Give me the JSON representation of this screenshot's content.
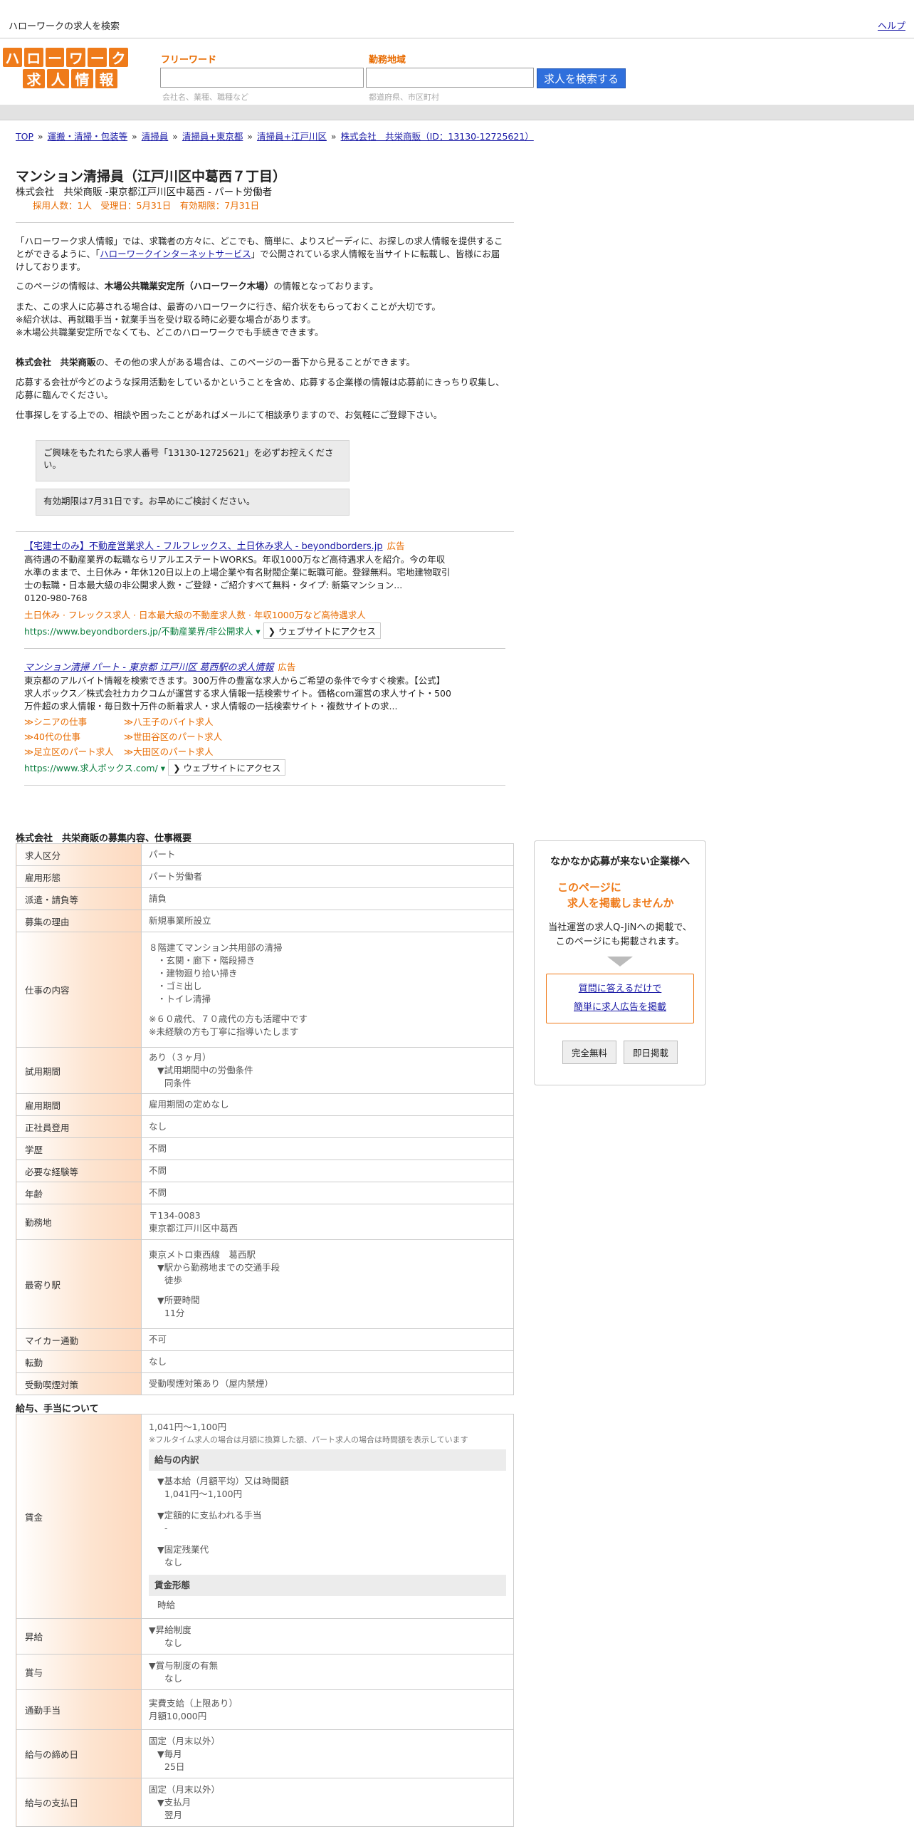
{
  "topbar": {
    "title": "ハローワークの求人を検索",
    "help": "ヘルプ"
  },
  "logo": {
    "row1": [
      "ハ",
      "ロ",
      "ー",
      "ワ",
      "ー",
      "ク"
    ],
    "row2": [
      "求",
      "人",
      "情",
      "報"
    ]
  },
  "search": {
    "freeword_label": "フリーワード",
    "freeword_hint": "会社名、業種、職種など",
    "area_label": "勤務地域",
    "area_hint": "都道府県、市区町村",
    "button": "求人を検索する"
  },
  "breadcrumb": [
    {
      "text": "TOP",
      "sep": " » "
    },
    {
      "text": "運搬・清掃・包装等",
      "sep": " » "
    },
    {
      "text": "清掃員",
      "sep": " » "
    },
    {
      "text": "清掃員+東京都",
      "sep": " » "
    },
    {
      "text": "清掃員+江戸川区",
      "sep": " » "
    },
    {
      "text": "株式会社　共栄商販（ID：13130-12725621）",
      "sep": ""
    }
  ],
  "job": {
    "title": "マンション清掃員（江戸川区中葛西７丁目）",
    "subtitle": "株式会社　共栄商販 -東京都江戸川区中葛西 - パート労働者",
    "meta": "採用人数：1人　受理日：5月31日　有効期限：7月31日"
  },
  "intro": {
    "p1a": "「ハローワーク求人情報」では、求職者の方々に、どこでも、簡単に、よりスピーディに、お探しの求人情報を提供することができるように、「",
    "p1link": "ハローワークインターネットサービス",
    "p1b": "」で公開されている求人情報を当サイトに転載し、皆様にお届けしております。",
    "p2a": "このページの情報は、",
    "p2b": "木場公共職業安定所（ハローワーク木場）",
    "p2c": "の情報となっております。",
    "p3": "また、この求人に応募される場合は、最寄のハローワークに行き、紹介状をもらっておくことが大切です。",
    "p4": "※紹介状は、再就職手当・就業手当を受け取る時に必要な場合があります。",
    "p5": "※木場公共職業安定所でなくても、どこのハローワークでも手続きできます。",
    "p6a": "株式会社　共栄商販",
    "p6b": "の、その他の求人がある場合は、このページの一番下から見ることができます。",
    "p7": "応募する会社が今どのような採用活動をしているかということを含め、応募する企業様の情報は応募前にきっちり収集し、応募に臨んでください。",
    "p8": "仕事探しをする上での、相談や困ったことがあればメールにて相談承りますので、お気軽にご登録下さい。"
  },
  "notices": [
    "ご興味をもたれたら求人番号「13130-12725621」を必ずお控えください。",
    "有効期限は7月31日です。お早めにご検討ください。"
  ],
  "ads": [
    {
      "title": "【宅建士のみ】不動産営業求人 - フルフレックス、土日休み求人 - beyondborders.jp",
      "badge": "広告",
      "desc": "高待遇の不動産業界の転職ならリアルエステートWORKS。年収1000万など高待遇求人を紹介。今の年収水準のままで、土日休み・年休120日以上の上場企業や有名財閥企業に転職可能。登録無料。宅地建物取引士の転職・日本最大級の非公開求人数・ご登録・ご紹介すべて無料・タイプ: 新築マンション...",
      "phone": "0120-980-768",
      "sub": "土日休み · フレックス求人 · 日本最大級の不動産求人数 · 年収1000万など高待遇求人",
      "url": "https://www.beyondborders.jp/不動産業界/非公開求人",
      "visit": "ウェブサイトにアクセス"
    },
    {
      "title": "マンション清掃 パート - 東京都 江戸川区 葛西駅の求人情報",
      "badge": "広告",
      "desc": "東京都のアルバイト情報を検索できます。300万件の豊富な求人からご希望の条件で今すぐ検索。【公式】求人ボックス／株式会社カカクコムが運営する求人情報一括検索サイト。価格com運営の求人サイト・500万件超の求人情報・毎日数十万件の新着求人・求人情報の一括検索サイト・複数サイトの求...",
      "links": [
        "≫シニアの仕事",
        "≫八王子のバイト求人",
        "≫40代の仕事",
        "≫世田谷区のパート求人",
        "≫足立区のパート求人",
        "≫大田区のパート求人"
      ],
      "url": "https://www.求人ボックス.com/",
      "visit": "ウェブサイトにアクセス"
    }
  ],
  "overview": {
    "heading": "株式会社　共栄商販の募集内容、仕事概要",
    "rows": [
      {
        "k": "求人区分",
        "v": [
          "パート"
        ]
      },
      {
        "k": "雇用形態",
        "v": [
          "パート労働者"
        ]
      },
      {
        "k": "派遣・請負等",
        "v": [
          "請負"
        ]
      },
      {
        "k": "募集の理由",
        "v": [
          "新規事業所設立"
        ]
      },
      {
        "k": "仕事の内容",
        "v": [
          "８階建てマンション共用部の清掃",
          "・玄関・廊下・階段掃き",
          "・建物廻り拾い掃き",
          "・ゴミ出し",
          "・トイレ清掃",
          "",
          "※６０歳代、７０歳代の方も活躍中です",
          "※未経験の方も丁寧に指導いたします"
        ]
      },
      {
        "k": "試用期間",
        "v": [
          "あり（３ヶ月）",
          "▼試用期間中の労働条件",
          "同条件"
        ]
      },
      {
        "k": "雇用期間",
        "v": [
          "雇用期間の定めなし"
        ]
      },
      {
        "k": "正社員登用",
        "v": [
          "なし"
        ]
      },
      {
        "k": "学歴",
        "v": [
          "不問"
        ]
      },
      {
        "k": "必要な経験等",
        "v": [
          "不問"
        ]
      },
      {
        "k": "年齢",
        "v": [
          "不問"
        ]
      },
      {
        "k": "勤務地",
        "v": [
          "〒134-0083",
          "東京都江戸川区中葛西"
        ]
      },
      {
        "k": "最寄り駅",
        "v": [
          "東京メトロ東西線　葛西駅",
          "▼駅から勤務地までの交通手段",
          "徒歩",
          "",
          "▼所要時間",
          "11分"
        ]
      },
      {
        "k": "マイカー通勤",
        "v": [
          "不可"
        ]
      },
      {
        "k": "転勤",
        "v": [
          "なし"
        ]
      },
      {
        "k": "受動喫煙対策",
        "v": [
          "受動喫煙対策あり（屋内禁煙）"
        ]
      }
    ]
  },
  "pay": {
    "heading": "給与、手当について",
    "wage_key": "賃金",
    "wage_value": "1,041円〜1,100円",
    "wage_note": "※フルタイム求人の場合は月額に換算した額、パート求人の場合は時間額を表示しています",
    "breakdown_head": "給与の内訳",
    "base_label": "▼基本給（月額平均）又は時間額",
    "base_value": "1,041円〜1,100円",
    "fixed_label": "▼定額的に支払われる手当",
    "fixed_value": "-",
    "ot_label": "▼固定残業代",
    "ot_value": "なし",
    "form_head": "賃金形態",
    "form_value": "時給",
    "rows": [
      {
        "k": "昇給",
        "v": [
          "▼昇給制度",
          "なし"
        ]
      },
      {
        "k": "賞与",
        "v": [
          "▼賞与制度の有無",
          "なし"
        ]
      },
      {
        "k": "通勤手当",
        "v": [
          "実費支給（上限あり）",
          "月額10,000円"
        ]
      },
      {
        "k": "給与の締め日",
        "v": [
          "固定（月末以外）",
          "▼毎月",
          "25日"
        ]
      },
      {
        "k": "給与の支払日",
        "v": [
          "固定（月末以外）",
          "▼支払月",
          "翌月"
        ]
      }
    ]
  },
  "side": {
    "heading": "なかなか応募が来ない企業様へ",
    "orange1": "このページに",
    "orange2": "求人を掲載しませんか",
    "desc1": "当社運営の求人Q-JiNへの掲載で、",
    "desc2": "このページにも掲載されます。",
    "link1": "質問に答えるだけで",
    "link2": "簡単に求人広告を掲載",
    "btn1": "完全無料",
    "btn2": "即日掲載"
  }
}
